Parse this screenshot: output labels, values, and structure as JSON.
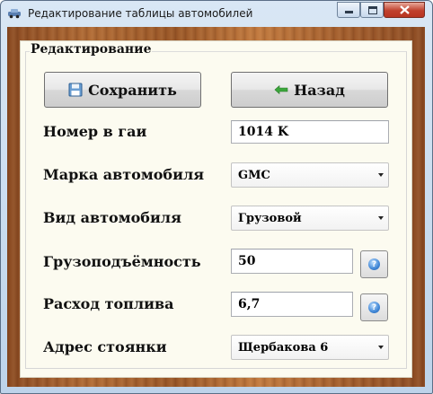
{
  "window": {
    "title": "Редактирование таблицы автомобилей",
    "controls": {
      "minimize": "minimize-icon",
      "maximize": "maximize-icon",
      "close": "close-icon"
    }
  },
  "group": {
    "title": "Редактирование"
  },
  "buttons": {
    "save": {
      "label": "Сохранить",
      "icon": "floppy-disk-icon"
    },
    "back": {
      "label": "Назад",
      "icon": "arrow-left-icon"
    }
  },
  "fields": {
    "plate": {
      "label": "Номер в гаи",
      "value": "1014 K"
    },
    "brand": {
      "label": "Марка автомобиля",
      "value": "GMC"
    },
    "type": {
      "label": "Вид автомобиля",
      "value": "Грузовой"
    },
    "capacity": {
      "label": "Грузоподъёмность",
      "value": "50"
    },
    "fuel": {
      "label": "Расход топлива",
      "value": "6,7"
    },
    "parking": {
      "label": "Адрес стоянки",
      "value": "Щербакова 6"
    }
  },
  "colors": {
    "background_wood": "#a45f2e",
    "panel": "#fcfbf0",
    "help_icon": "#3f86d6",
    "close_button": "#c0402d"
  }
}
